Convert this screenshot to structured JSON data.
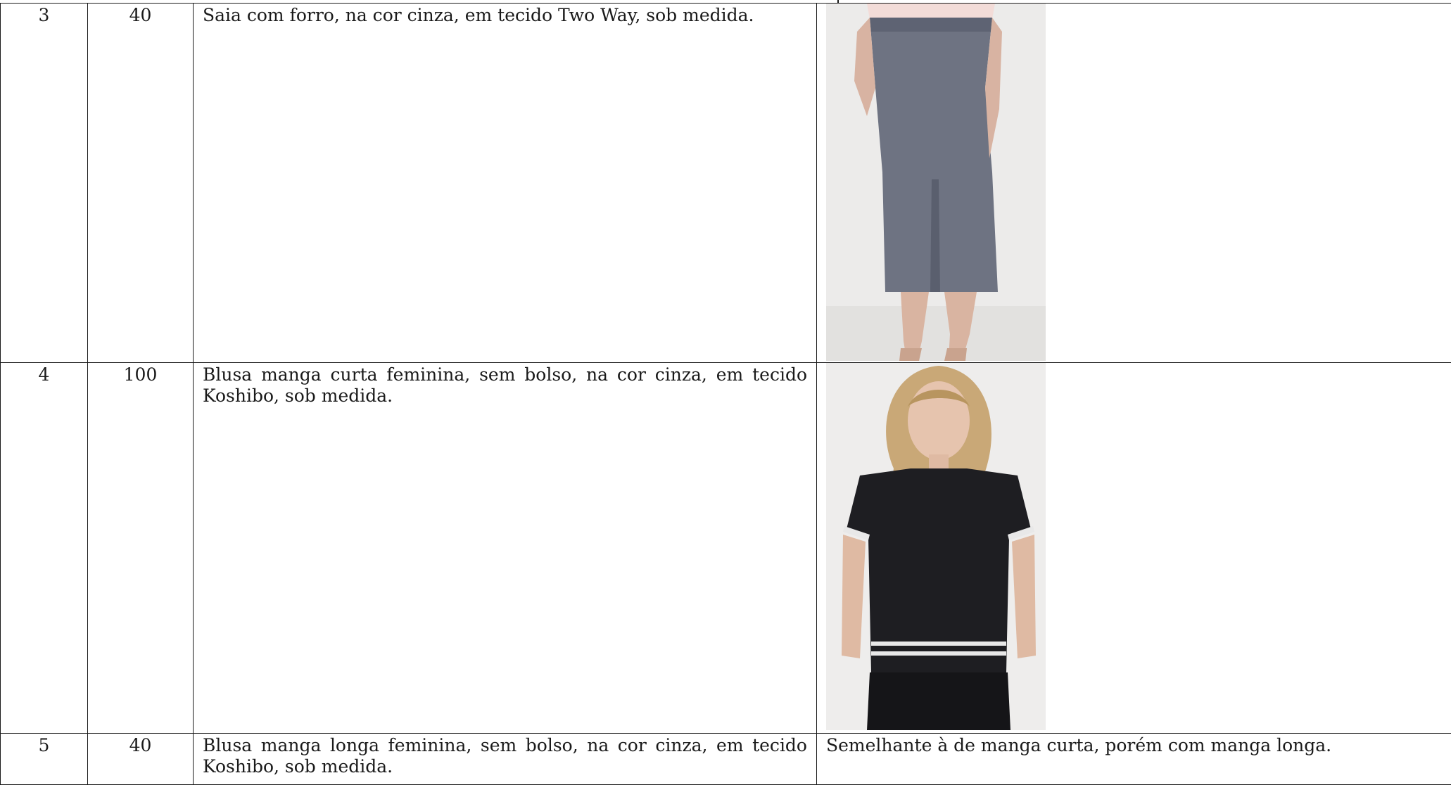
{
  "table": {
    "rows": [
      {
        "item": "3",
        "quantity": "40",
        "description": "Saia com forro, na cor cinza, em tecido Two Way, sob medida.",
        "image": "skirt-photo"
      },
      {
        "item": "4",
        "quantity": "100",
        "description": "Blusa manga curta feminina, sem bolso, na cor cinza, em tecido Koshibo, sob medida.",
        "image": "short-sleeve-blouse-photo"
      },
      {
        "item": "5",
        "quantity": "40",
        "description": "Blusa manga longa feminina, sem bolso, na cor cinza, em tecido Koshibo, sob medida.",
        "note": "Semelhante à de manga curta, porém com manga longa."
      }
    ]
  },
  "colors": {
    "border": "#1a1a1a",
    "skirt": "#6e7382",
    "blouse": "#1e1e22",
    "stripe": "#e8e8e8"
  }
}
